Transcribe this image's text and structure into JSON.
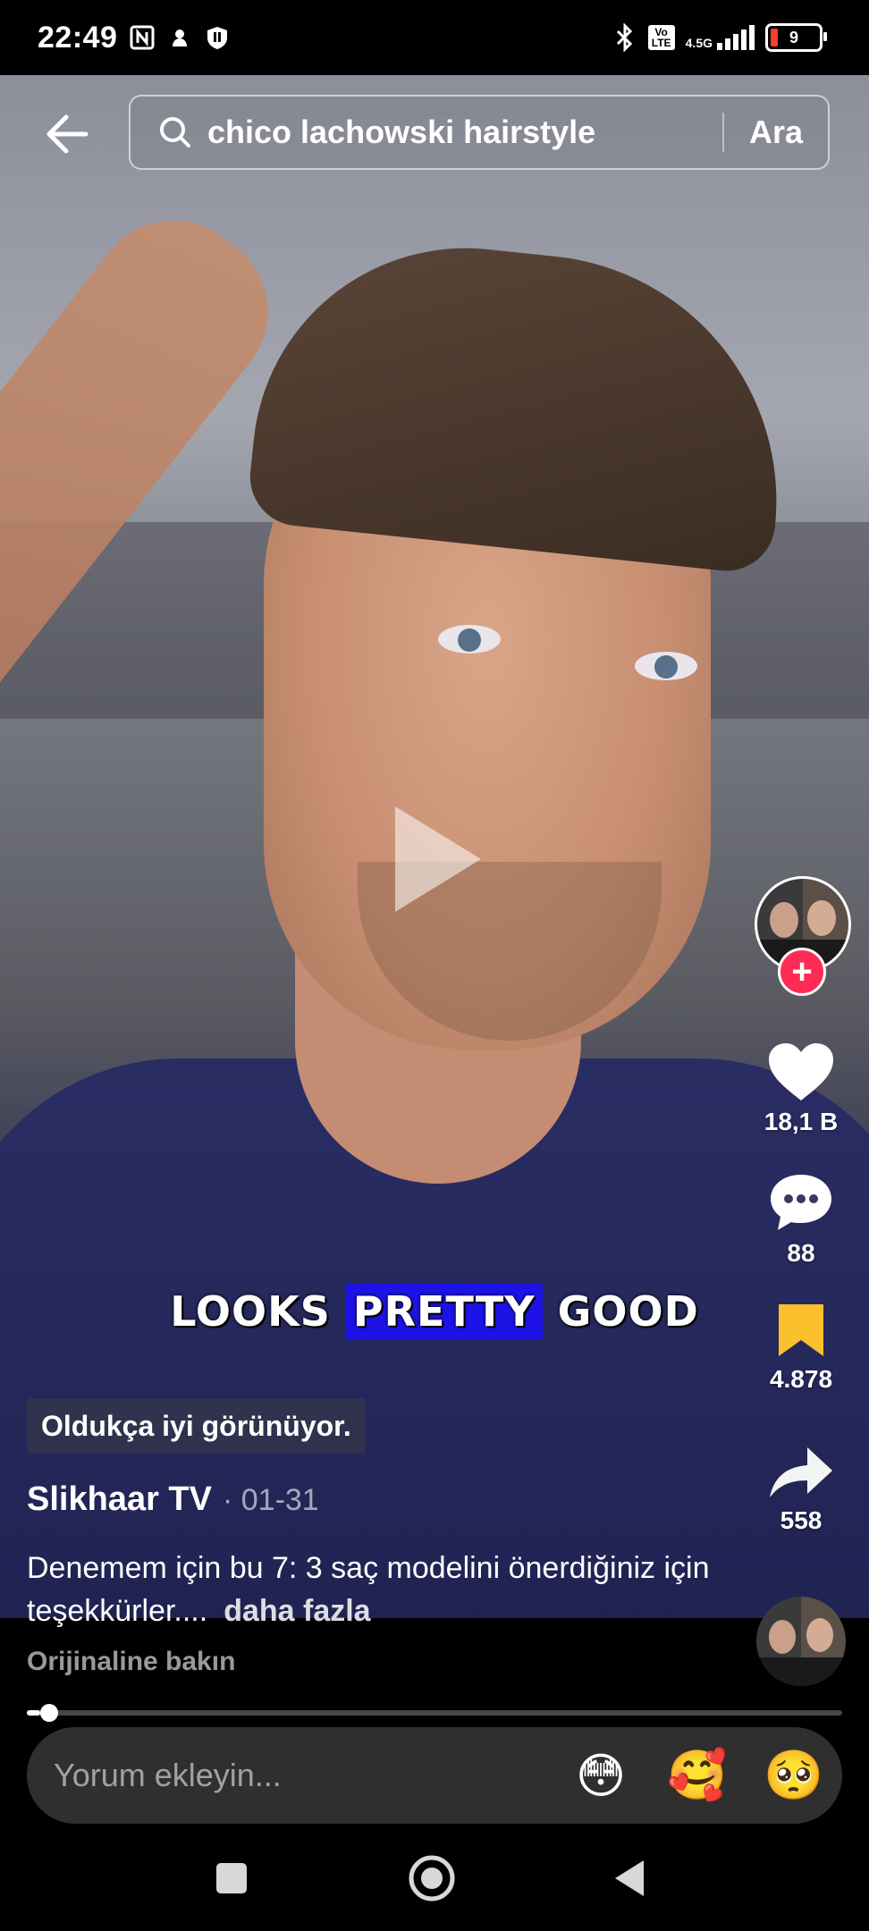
{
  "status_bar": {
    "time": "22:49",
    "network": "4.5G",
    "volte": "Vo LTE",
    "battery": "9",
    "battery_color": "#ff3b30"
  },
  "search": {
    "query": "chico lachowski hairstyle",
    "button_label": "Ara"
  },
  "video": {
    "caption_words": [
      "LOOKS",
      "PRETTY",
      "GOOD"
    ],
    "highlight_color": "#1d13e6",
    "translation": "Oldukça iyi görünüyor."
  },
  "actions": {
    "likes": "18,1 B",
    "comments": "88",
    "bookmarks": "4.878",
    "shares": "558",
    "follow_symbol": "+",
    "follow_color": "#fe2c55",
    "bookmark_color": "#fbc02d"
  },
  "post": {
    "author": "Slikhaar TV",
    "date": "· 01-31",
    "description": "Denemem için bu 7: 3 saç modelini önerdiğiniz için teşekkürler....",
    "more_label": "daha fazla",
    "see_original": "Orijinaline bakın"
  },
  "playback": {
    "progress": 0.016
  },
  "comment_bar": {
    "placeholder": "Yorum ekleyin...",
    "emojis": [
      "😳",
      "🥰",
      "🥺"
    ]
  }
}
